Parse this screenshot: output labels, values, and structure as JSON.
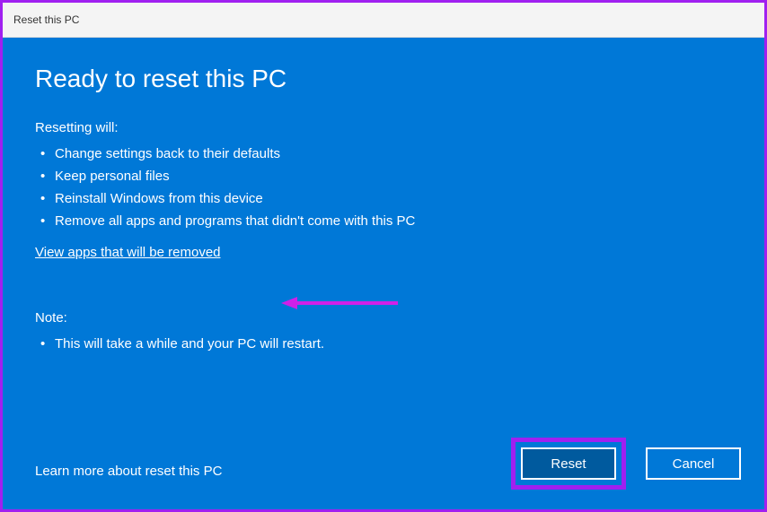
{
  "window": {
    "title": "Reset this PC"
  },
  "heading": "Ready to reset this PC",
  "resetting": {
    "label": "Resetting will:",
    "items": [
      "Change settings back to their defaults",
      "Keep personal files",
      "Reinstall Windows from this device",
      "Remove all apps and programs that didn't come with this PC"
    ]
  },
  "view_apps_link": "View apps that will be removed",
  "note": {
    "label": "Note:",
    "items": [
      "This will take a while and your PC will restart."
    ]
  },
  "footer_link": "Learn more about reset this PC",
  "buttons": {
    "reset": "Reset",
    "cancel": "Cancel"
  }
}
